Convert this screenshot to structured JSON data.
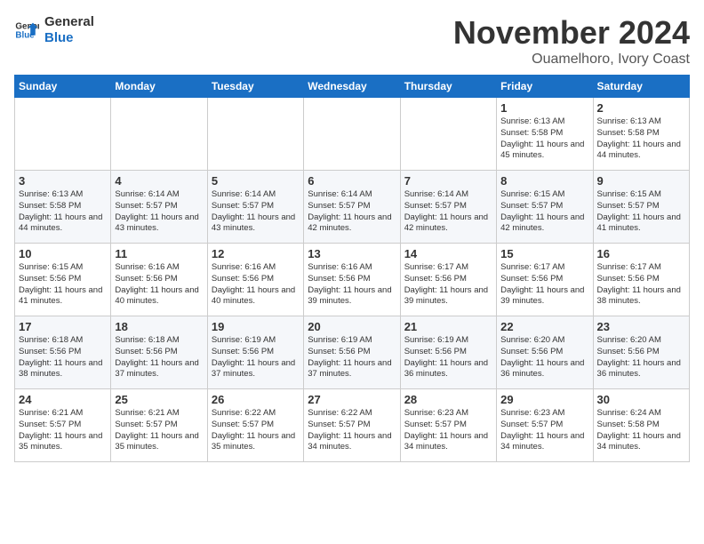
{
  "logo": {
    "line1": "General",
    "line2": "Blue"
  },
  "title": "November 2024",
  "subtitle": "Ouamelhoro, Ivory Coast",
  "weekdays": [
    "Sunday",
    "Monday",
    "Tuesday",
    "Wednesday",
    "Thursday",
    "Friday",
    "Saturday"
  ],
  "weeks": [
    [
      {
        "day": "",
        "info": ""
      },
      {
        "day": "",
        "info": ""
      },
      {
        "day": "",
        "info": ""
      },
      {
        "day": "",
        "info": ""
      },
      {
        "day": "",
        "info": ""
      },
      {
        "day": "1",
        "info": "Sunrise: 6:13 AM\nSunset: 5:58 PM\nDaylight: 11 hours\nand 45 minutes."
      },
      {
        "day": "2",
        "info": "Sunrise: 6:13 AM\nSunset: 5:58 PM\nDaylight: 11 hours\nand 44 minutes."
      }
    ],
    [
      {
        "day": "3",
        "info": "Sunrise: 6:13 AM\nSunset: 5:58 PM\nDaylight: 11 hours\nand 44 minutes."
      },
      {
        "day": "4",
        "info": "Sunrise: 6:14 AM\nSunset: 5:57 PM\nDaylight: 11 hours\nand 43 minutes."
      },
      {
        "day": "5",
        "info": "Sunrise: 6:14 AM\nSunset: 5:57 PM\nDaylight: 11 hours\nand 43 minutes."
      },
      {
        "day": "6",
        "info": "Sunrise: 6:14 AM\nSunset: 5:57 PM\nDaylight: 11 hours\nand 42 minutes."
      },
      {
        "day": "7",
        "info": "Sunrise: 6:14 AM\nSunset: 5:57 PM\nDaylight: 11 hours\nand 42 minutes."
      },
      {
        "day": "8",
        "info": "Sunrise: 6:15 AM\nSunset: 5:57 PM\nDaylight: 11 hours\nand 42 minutes."
      },
      {
        "day": "9",
        "info": "Sunrise: 6:15 AM\nSunset: 5:57 PM\nDaylight: 11 hours\nand 41 minutes."
      }
    ],
    [
      {
        "day": "10",
        "info": "Sunrise: 6:15 AM\nSunset: 5:56 PM\nDaylight: 11 hours\nand 41 minutes."
      },
      {
        "day": "11",
        "info": "Sunrise: 6:16 AM\nSunset: 5:56 PM\nDaylight: 11 hours\nand 40 minutes."
      },
      {
        "day": "12",
        "info": "Sunrise: 6:16 AM\nSunset: 5:56 PM\nDaylight: 11 hours\nand 40 minutes."
      },
      {
        "day": "13",
        "info": "Sunrise: 6:16 AM\nSunset: 5:56 PM\nDaylight: 11 hours\nand 39 minutes."
      },
      {
        "day": "14",
        "info": "Sunrise: 6:17 AM\nSunset: 5:56 PM\nDaylight: 11 hours\nand 39 minutes."
      },
      {
        "day": "15",
        "info": "Sunrise: 6:17 AM\nSunset: 5:56 PM\nDaylight: 11 hours\nand 39 minutes."
      },
      {
        "day": "16",
        "info": "Sunrise: 6:17 AM\nSunset: 5:56 PM\nDaylight: 11 hours\nand 38 minutes."
      }
    ],
    [
      {
        "day": "17",
        "info": "Sunrise: 6:18 AM\nSunset: 5:56 PM\nDaylight: 11 hours\nand 38 minutes."
      },
      {
        "day": "18",
        "info": "Sunrise: 6:18 AM\nSunset: 5:56 PM\nDaylight: 11 hours\nand 37 minutes."
      },
      {
        "day": "19",
        "info": "Sunrise: 6:19 AM\nSunset: 5:56 PM\nDaylight: 11 hours\nand 37 minutes."
      },
      {
        "day": "20",
        "info": "Sunrise: 6:19 AM\nSunset: 5:56 PM\nDaylight: 11 hours\nand 37 minutes."
      },
      {
        "day": "21",
        "info": "Sunrise: 6:19 AM\nSunset: 5:56 PM\nDaylight: 11 hours\nand 36 minutes."
      },
      {
        "day": "22",
        "info": "Sunrise: 6:20 AM\nSunset: 5:56 PM\nDaylight: 11 hours\nand 36 minutes."
      },
      {
        "day": "23",
        "info": "Sunrise: 6:20 AM\nSunset: 5:56 PM\nDaylight: 11 hours\nand 36 minutes."
      }
    ],
    [
      {
        "day": "24",
        "info": "Sunrise: 6:21 AM\nSunset: 5:57 PM\nDaylight: 11 hours\nand 35 minutes."
      },
      {
        "day": "25",
        "info": "Sunrise: 6:21 AM\nSunset: 5:57 PM\nDaylight: 11 hours\nand 35 minutes."
      },
      {
        "day": "26",
        "info": "Sunrise: 6:22 AM\nSunset: 5:57 PM\nDaylight: 11 hours\nand 35 minutes."
      },
      {
        "day": "27",
        "info": "Sunrise: 6:22 AM\nSunset: 5:57 PM\nDaylight: 11 hours\nand 34 minutes."
      },
      {
        "day": "28",
        "info": "Sunrise: 6:23 AM\nSunset: 5:57 PM\nDaylight: 11 hours\nand 34 minutes."
      },
      {
        "day": "29",
        "info": "Sunrise: 6:23 AM\nSunset: 5:57 PM\nDaylight: 11 hours\nand 34 minutes."
      },
      {
        "day": "30",
        "info": "Sunrise: 6:24 AM\nSunset: 5:58 PM\nDaylight: 11 hours\nand 34 minutes."
      }
    ]
  ]
}
